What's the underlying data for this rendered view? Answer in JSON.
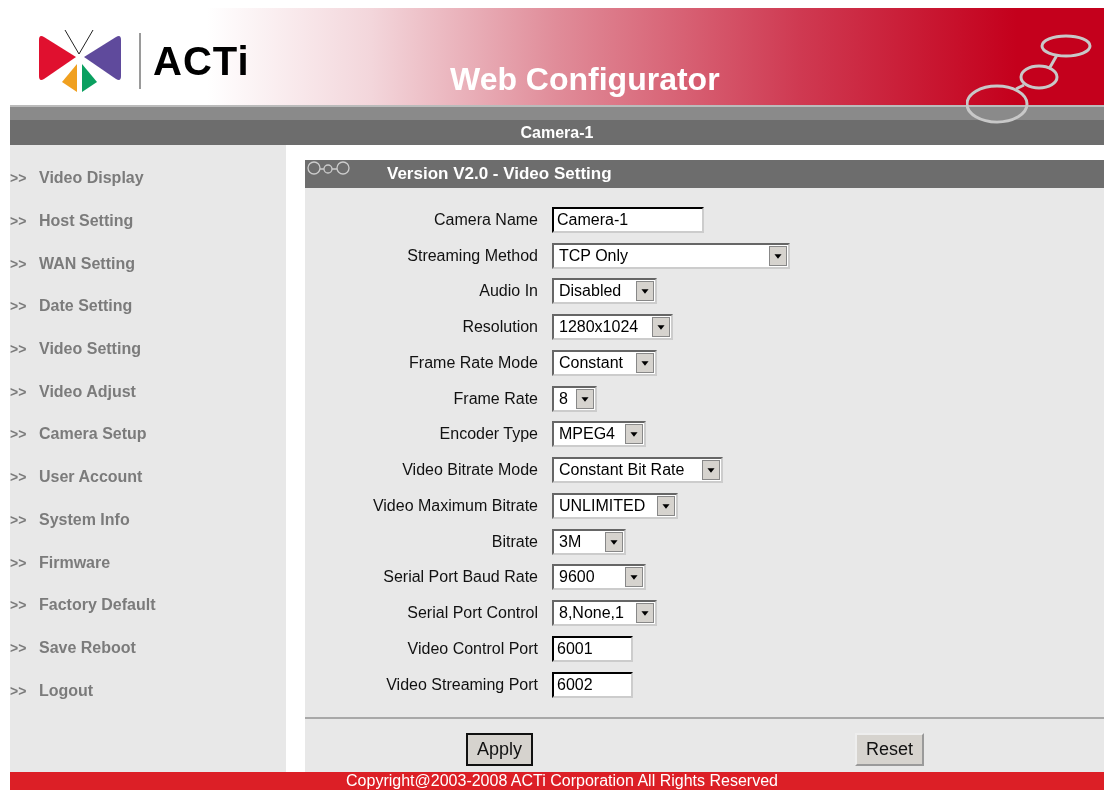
{
  "header": {
    "logo_text": "ACTi",
    "title": "Web Configurator"
  },
  "device_bar": {
    "name": "Camera-1"
  },
  "sidebar": {
    "items": [
      {
        "marker": ">>",
        "label": "Video Display"
      },
      {
        "marker": ">>",
        "label": "Host Setting"
      },
      {
        "marker": ">>",
        "label": "WAN Setting"
      },
      {
        "marker": ">>",
        "label": "Date Setting"
      },
      {
        "marker": ">>",
        "label": "Video Setting"
      },
      {
        "marker": ">>",
        "label": "Video Adjust"
      },
      {
        "marker": ">>",
        "label": "Camera Setup"
      },
      {
        "marker": ">>",
        "label": "User Account"
      },
      {
        "marker": ">>",
        "label": "System Info"
      },
      {
        "marker": ">>",
        "label": "Firmware"
      },
      {
        "marker": ">>",
        "label": "Factory Default"
      },
      {
        "marker": ">>",
        "label": "Save Reboot"
      },
      {
        "marker": ">>",
        "label": "Logout"
      }
    ]
  },
  "panel": {
    "title": "Version V2.0 - Video Setting",
    "fields": [
      {
        "kind": "text",
        "label": "Camera Name",
        "value": "Camera-1"
      },
      {
        "kind": "select",
        "label": "Streaming Method",
        "value": "TCP Only"
      },
      {
        "kind": "select",
        "label": "Audio In",
        "value": "Disabled"
      },
      {
        "kind": "select",
        "label": "Resolution",
        "value": "1280x1024"
      },
      {
        "kind": "select",
        "label": "Frame Rate Mode",
        "value": "Constant"
      },
      {
        "kind": "select",
        "label": "Frame Rate",
        "value": "8"
      },
      {
        "kind": "select",
        "label": "Encoder Type",
        "value": "MPEG4"
      },
      {
        "kind": "select",
        "label": "Video Bitrate Mode",
        "value": "Constant Bit Rate"
      },
      {
        "kind": "select",
        "label": "Video Maximum Bitrate",
        "value": "UNLIMITED"
      },
      {
        "kind": "select",
        "label": "Bitrate",
        "value": "3M"
      },
      {
        "kind": "select",
        "label": "Serial Port Baud Rate",
        "value": "9600"
      },
      {
        "kind": "select",
        "label": "Serial Port Control",
        "value": "8,None,1"
      },
      {
        "kind": "text",
        "label": "Video Control Port",
        "value": "6001"
      },
      {
        "kind": "text",
        "label": "Video Streaming Port",
        "value": "6002"
      }
    ],
    "buttons": [
      {
        "label": "Apply",
        "focused": true
      },
      {
        "label": "Reset",
        "focused": false
      }
    ]
  },
  "footer": {
    "text": "Copyright@2003-2008 ACTi Corporation All Rights Reserved"
  }
}
